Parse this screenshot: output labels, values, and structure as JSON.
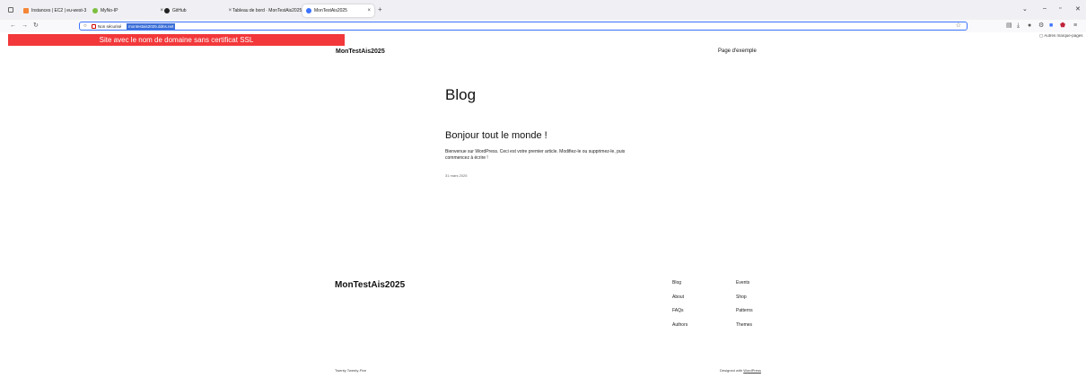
{
  "browser": {
    "tabs": [
      {
        "label": "Instances | EC2 | eu-west-3",
        "color": "#f58536"
      },
      {
        "label": "MyNo-IP",
        "color": "#7cbf3e"
      },
      {
        "label": "GitHub",
        "color": "#222222"
      },
      {
        "label": "Tableau de bord · MonTestAis2025 ·",
        "color": "#5a6570"
      },
      {
        "label": "MonTestAis2025",
        "color": "#3b73ff"
      }
    ],
    "new_tab_label": "+",
    "url": {
      "insecure_label": "Non sécurisé",
      "text": "montestais2025.ddns.net"
    },
    "window_controls": {
      "minimize": "–",
      "maximize": "▫",
      "close": "✕",
      "list_tabs": "⌄"
    },
    "bookmarks_label": "Autres marque-pages"
  },
  "banner": {
    "text": "Site avec le nom de domaine sans certificat SSL",
    "color": "#f2383a"
  },
  "site": {
    "header": {
      "title": "MonTestAis2025",
      "nav_link": "Page d'exemple"
    },
    "main": {
      "heading": "Blog",
      "post": {
        "title": "Bonjour tout le monde !",
        "excerpt": "Bienvenue sur WordPress. Ceci est votre premier article. Modifiez-le ou supprimez-le, puis commencez à écrire !",
        "date": "31 mars 2025"
      }
    },
    "footer": {
      "title": "MonTestAis2025",
      "links_col1": [
        "Blog",
        "About",
        "FAQs",
        "Authors"
      ],
      "links_col2": [
        "Events",
        "Shop",
        "Patterns",
        "Themes"
      ],
      "theme_credit": "Twenty Twenty-Five",
      "designed_with": "Designed with",
      "wordpress": "WordPress"
    }
  }
}
